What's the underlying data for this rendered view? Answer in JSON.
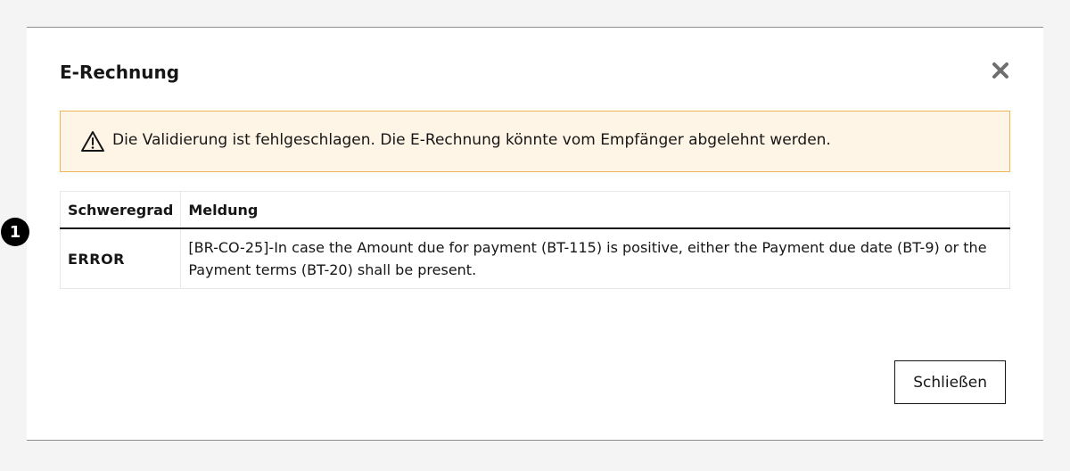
{
  "dialog": {
    "title": "E-Rechnung",
    "close_icon": "close-icon"
  },
  "warning": {
    "icon": "warning-icon",
    "text": "Die Validierung ist fehlgeschlagen. Die E-Rechnung könnte vom Empfänger abgelehnt werden.",
    "background": "#fff5e6",
    "border": "#f0b357"
  },
  "table": {
    "columns": [
      "Schweregrad",
      "Meldung"
    ],
    "rows": [
      {
        "badge": "1",
        "severity": "ERROR",
        "message": "[BR-CO-25]-In case the Amount due for payment (BT-115) is positive, either the Payment due date (BT-9) or the Payment terms (BT-20) shall be present."
      }
    ]
  },
  "footer": {
    "close_label": "Schließen"
  }
}
